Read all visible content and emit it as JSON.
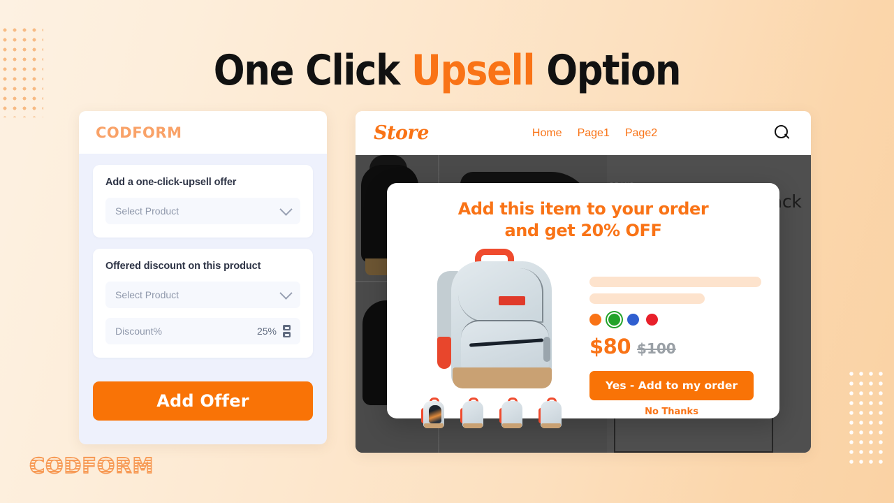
{
  "headline": {
    "part1": "One Click ",
    "accent": "Upsell",
    "part2": " Option"
  },
  "colors": {
    "accent_orange": "#f97316",
    "button_orange": "#f97306",
    "panel_bg": "#eef1fc",
    "card_bg": "#ffffff",
    "placeholder_bar": "#fde3cd"
  },
  "app_panel": {
    "brand": "CODFORM",
    "upsell_card": {
      "title": "Add a one-click-upsell offer",
      "select_placeholder": "Select Product"
    },
    "discount_card": {
      "title": "Offered discount on this product",
      "select_placeholder": "Select Product",
      "discount_label": "Discount%",
      "discount_value": "25%"
    },
    "add_offer_label": "Add Offer"
  },
  "store": {
    "logo": "Store",
    "nav": [
      "Home",
      "Page1",
      "Page2"
    ],
    "search_icon": "search-icon",
    "product": {
      "brand": "BRAND",
      "title": "The Outdoor Backpack"
    }
  },
  "upsell_modal": {
    "heading_line1": "Add this item to your order",
    "heading_line2": "and get 20% OFF",
    "swatches": [
      {
        "name": "orange",
        "hex": "#f97316",
        "selected": false
      },
      {
        "name": "green",
        "hex": "#22a32a",
        "selected": true
      },
      {
        "name": "blue",
        "hex": "#2f5fd0",
        "selected": false
      },
      {
        "name": "red",
        "hex": "#e8202a",
        "selected": false
      }
    ],
    "price_new": "$80",
    "price_old": "$100",
    "cta_label": "Yes - Add to my order",
    "decline_label": "No Thanks"
  },
  "watermark": "CODFORM"
}
